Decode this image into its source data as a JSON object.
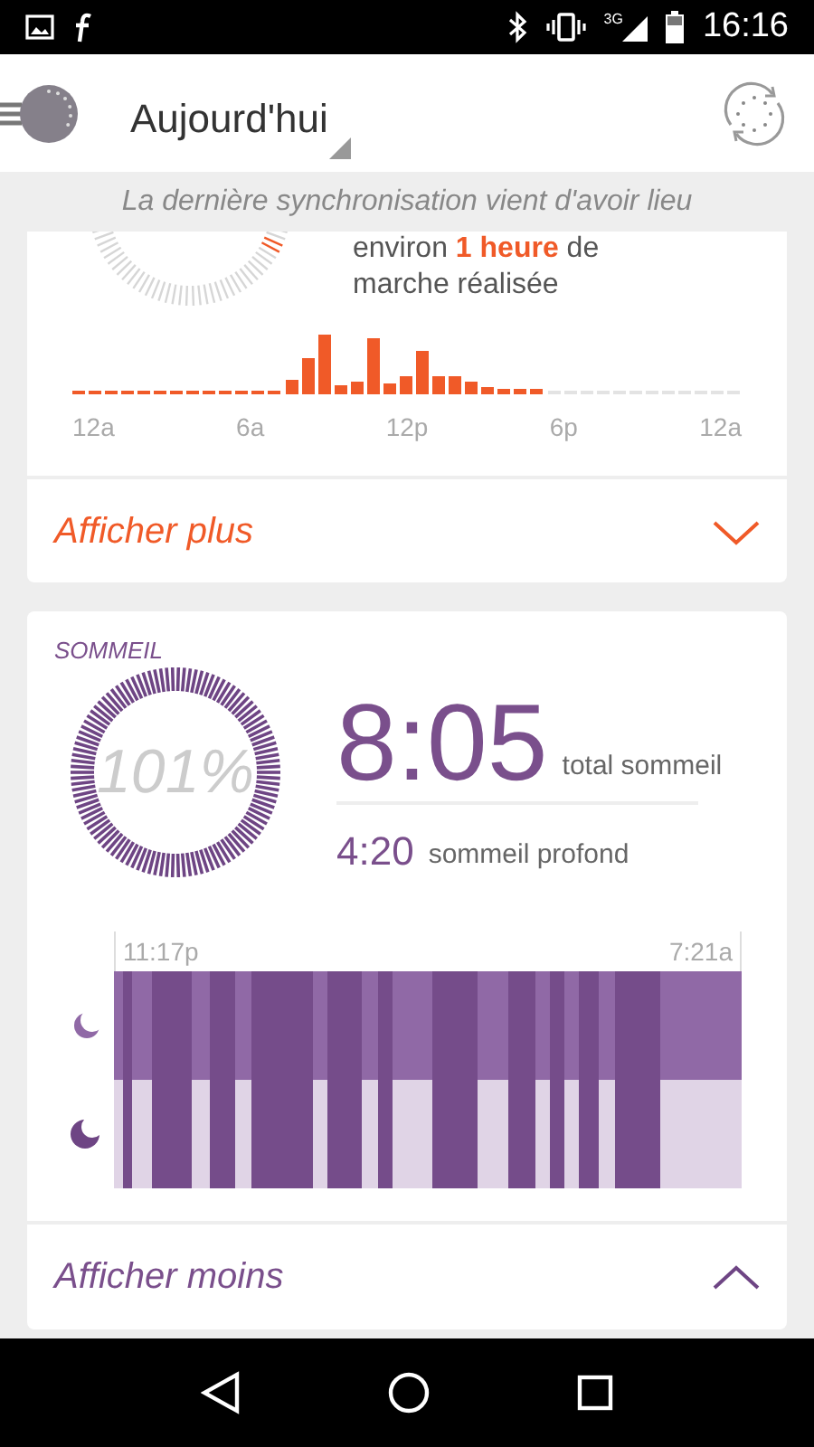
{
  "status_bar": {
    "network": "3G",
    "time": "16:16"
  },
  "app_bar": {
    "title": "Aujourd'hui"
  },
  "sync_banner": "La dernière synchronisation vient d'avoir lieu",
  "activity_card": {
    "summary": "environ **1 heure** de marche réalisée",
    "x_labels": [
      "12a",
      "6a",
      "12p",
      "6p",
      "12a"
    ],
    "toggle": "Afficher plus",
    "expanded": false
  },
  "sleep_card": {
    "title": "SOMMEIL",
    "percent": "101%",
    "total": "8:05",
    "total_label": "total sommeil",
    "deep": "4:20",
    "deep_label": "sommeil profond",
    "start": "11:17p",
    "end": "7:21a",
    "toggle": "Afficher moins",
    "expanded": true
  }
}
